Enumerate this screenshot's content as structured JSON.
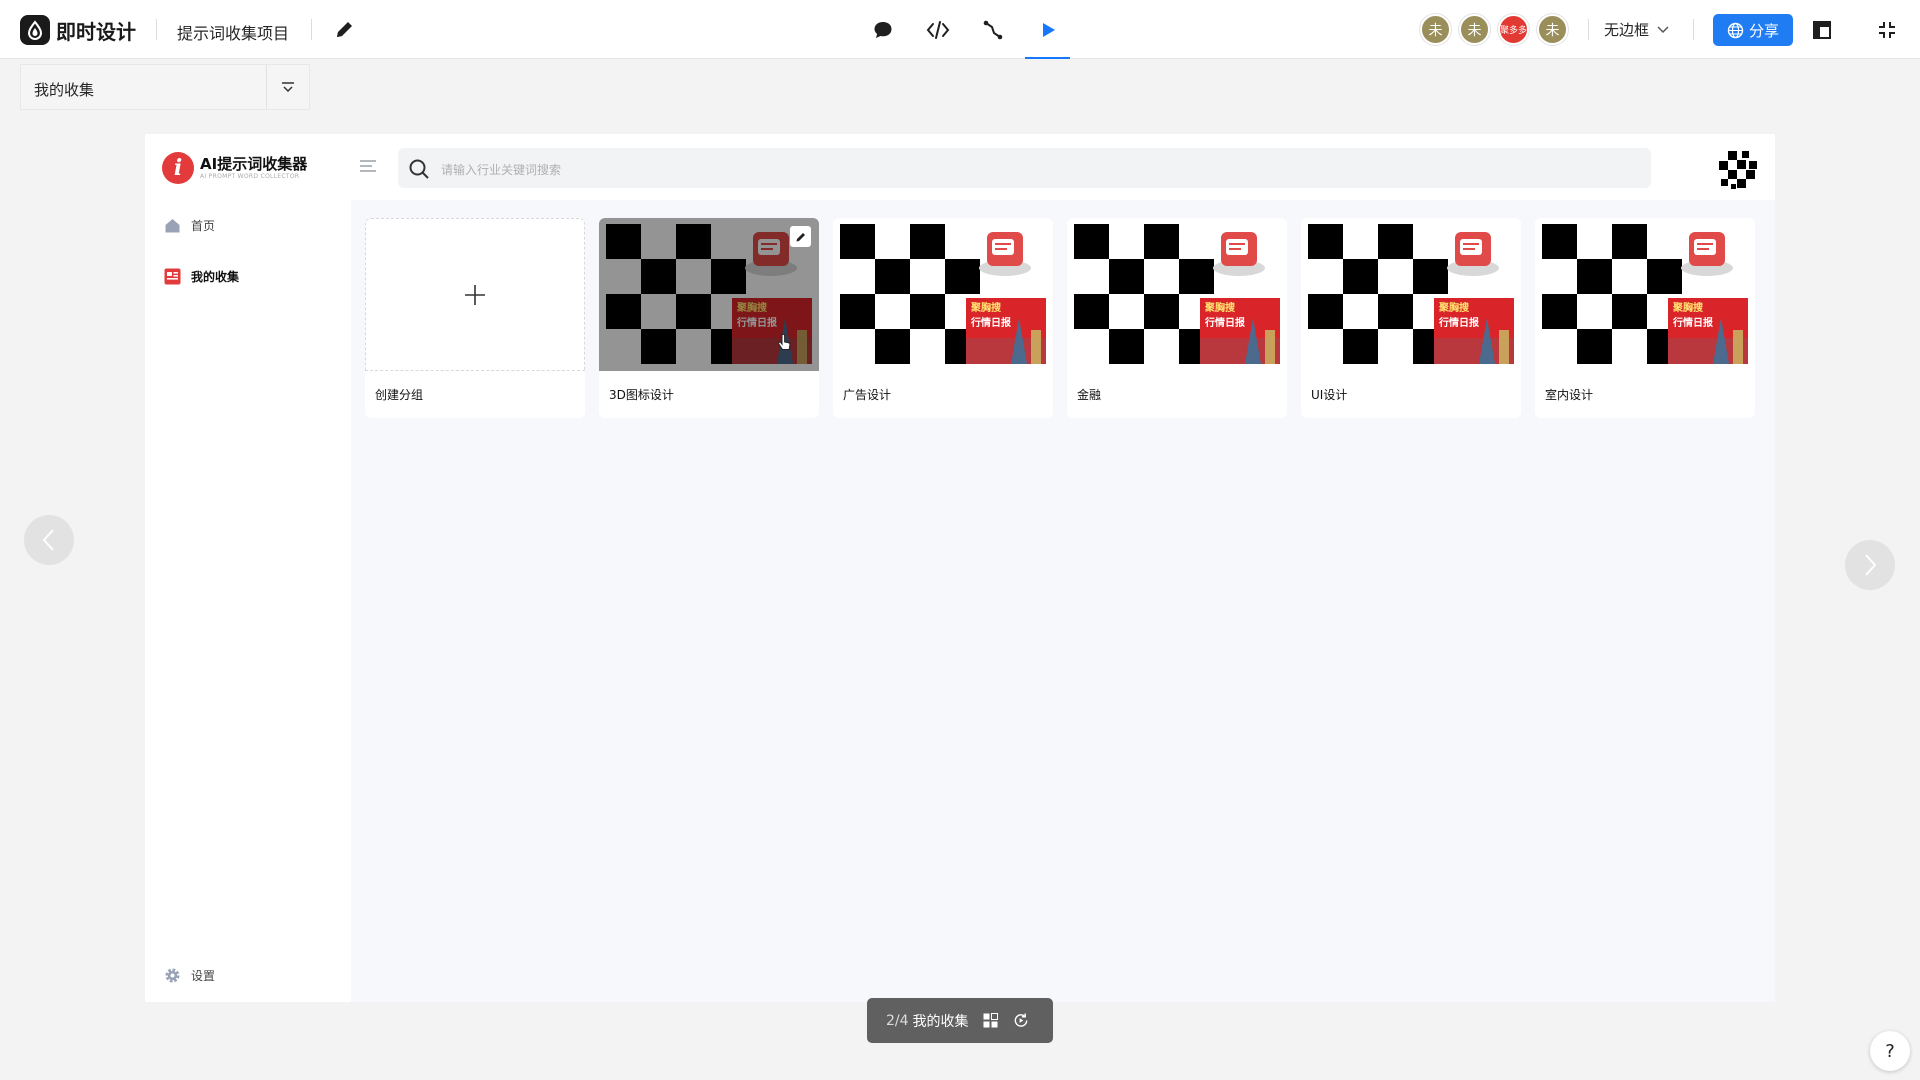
{
  "app": {
    "name": "即时设计"
  },
  "toolbar": {
    "project_name": "提示词收集项目",
    "frame_mode": "无边框",
    "share_label": "分享",
    "avatars": [
      "未",
      "未",
      "聚多多",
      "未"
    ],
    "colors": {
      "accent": "#1f7cf2",
      "avatar": "#9a8f5b"
    }
  },
  "page_selector": {
    "current": "我的收集"
  },
  "prototype": {
    "brand": {
      "title": "AI提示词收集器",
      "subtitle": "AI PROMPT WORD COLLECTOR"
    },
    "nav": [
      {
        "label": "首页",
        "icon": "home-icon"
      },
      {
        "label": "我的收集",
        "icon": "collection-icon",
        "active": true
      }
    ],
    "settings_label": "设置",
    "search": {
      "placeholder": "请输入行业关键词搜索"
    },
    "cards": [
      {
        "label": "创建分组",
        "type": "add"
      },
      {
        "label": "3D图标设计",
        "hovered": true
      },
      {
        "label": "广告设计"
      },
      {
        "label": "金融"
      },
      {
        "label": "UI设计"
      },
      {
        "label": "室内设计"
      }
    ],
    "banner_lines": [
      "聚胸搜",
      "行情日报"
    ]
  },
  "pager": {
    "position": "2/4",
    "title": "我的收集"
  },
  "help_label": "?"
}
